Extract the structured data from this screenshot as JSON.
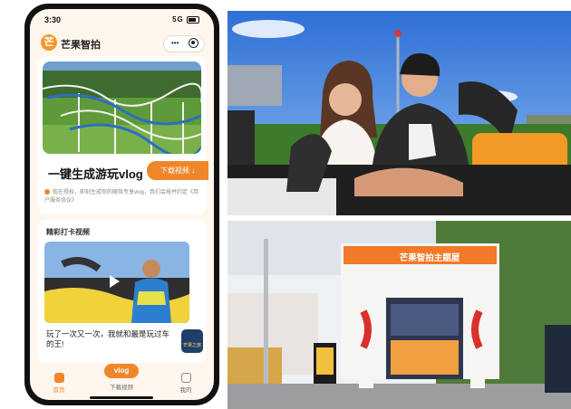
{
  "phone": {
    "status_bar": {
      "time": "3:30",
      "network": "5G"
    },
    "app_bar": {
      "logo_glyph": "芒",
      "title": "芒果智拍",
      "more_glyph": "•••",
      "target_icon": "target-icon"
    },
    "vlog_card": {
      "title": "一键生成游玩vlog",
      "download_label": "下载视频 ↓",
      "notice": "现在授权，即刻生成你的随驾专享vlog，我们会按并约定《用户服务协议》"
    },
    "video_card": {
      "section_title": "精彩打卡视频",
      "caption": "玩了一次又一次，我就和最是玩过车的王!",
      "badge": "芒果之旅"
    },
    "tab_bar": {
      "home": "首页",
      "download_pill": "vlog",
      "download": "下载视频",
      "me": "我的"
    }
  },
  "kiosk_sign": "芒果智拍主题屋",
  "colors": {
    "accent": "#f0862a",
    "screen_bg": "#fff6ee",
    "sky_blue": "#4d88e0",
    "kiosk_orange": "#f07a2a"
  }
}
